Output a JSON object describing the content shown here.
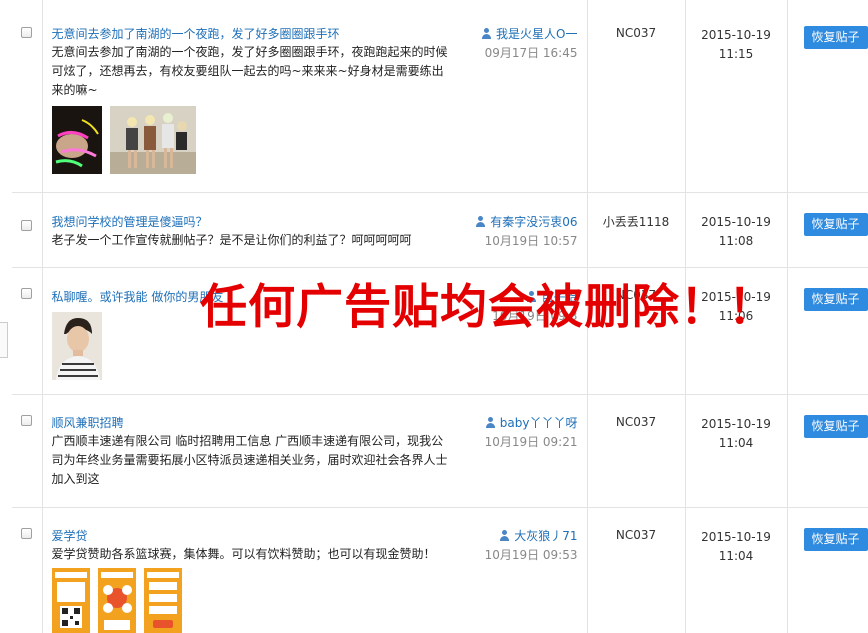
{
  "posts": [
    {
      "title": "无意间去参加了南湖的一个夜跑，发了好多圈圈跟手环",
      "body": "无意间去参加了南湖的一个夜跑，发了好多圈圈跟手环，夜跑跑起来的时候可炫了，还想再去，有校友要组队一起去的吗~来来来~好身材是需要练出来的嘛~",
      "author": "我是火星人O一",
      "time": "09月17日 16:45",
      "reply_to": "NC037",
      "date": "2015-10-19",
      "clock": "11:15",
      "button": "恢复贴子"
    },
    {
      "title": "我想问学校的管理是傻逼吗？",
      "body": "老子发一个工作宣传就删帖子？是不是让你们的利益了？呵呵呵呵呵",
      "author": "有秦字没污衷06",
      "time": "10月19日 10:57",
      "reply_to": "小丢丢1118",
      "date": "2015-10-19",
      "clock": "11:08",
      "button": "恢复贴子"
    },
    {
      "title": "私聊喔。或许我能 做你的男朋友",
      "body": "",
      "author": "苗子恰",
      "time": "10月19日 09:3",
      "reply_to": "NC037",
      "date": "2015-10-19",
      "clock": "11:06",
      "button": "恢复贴子"
    },
    {
      "title": "顺风兼职招聘",
      "body": "广西顺丰速递有限公司 临时招聘用工信息 广西顺丰速递有限公司，现我公司为年终业务量需要拓展小区特派员速递相关业务，届时欢迎社会各界人士加入到这",
      "author": "baby丫丫丫呀",
      "time": "10月19日 09:21",
      "reply_to": "NC037",
      "date": "2015-10-19",
      "clock": "11:04",
      "button": "恢复贴子"
    },
    {
      "title": "爱学贷",
      "body": "爱学贷赞助各系篮球赛，集体舞。可以有饮料赞助；也可以有现金赞助！",
      "author": "大灰狼丿71",
      "time": "10月19日 09:53",
      "reply_to": "NC037",
      "date": "2015-10-19",
      "clock": "11:04",
      "button": "恢复贴子"
    }
  ],
  "overlay_notice": "任何广告贴均会被删除！！",
  "colors": {
    "link": "#1d6fb8",
    "button": "#2f8be0",
    "notice": "#e40000"
  }
}
